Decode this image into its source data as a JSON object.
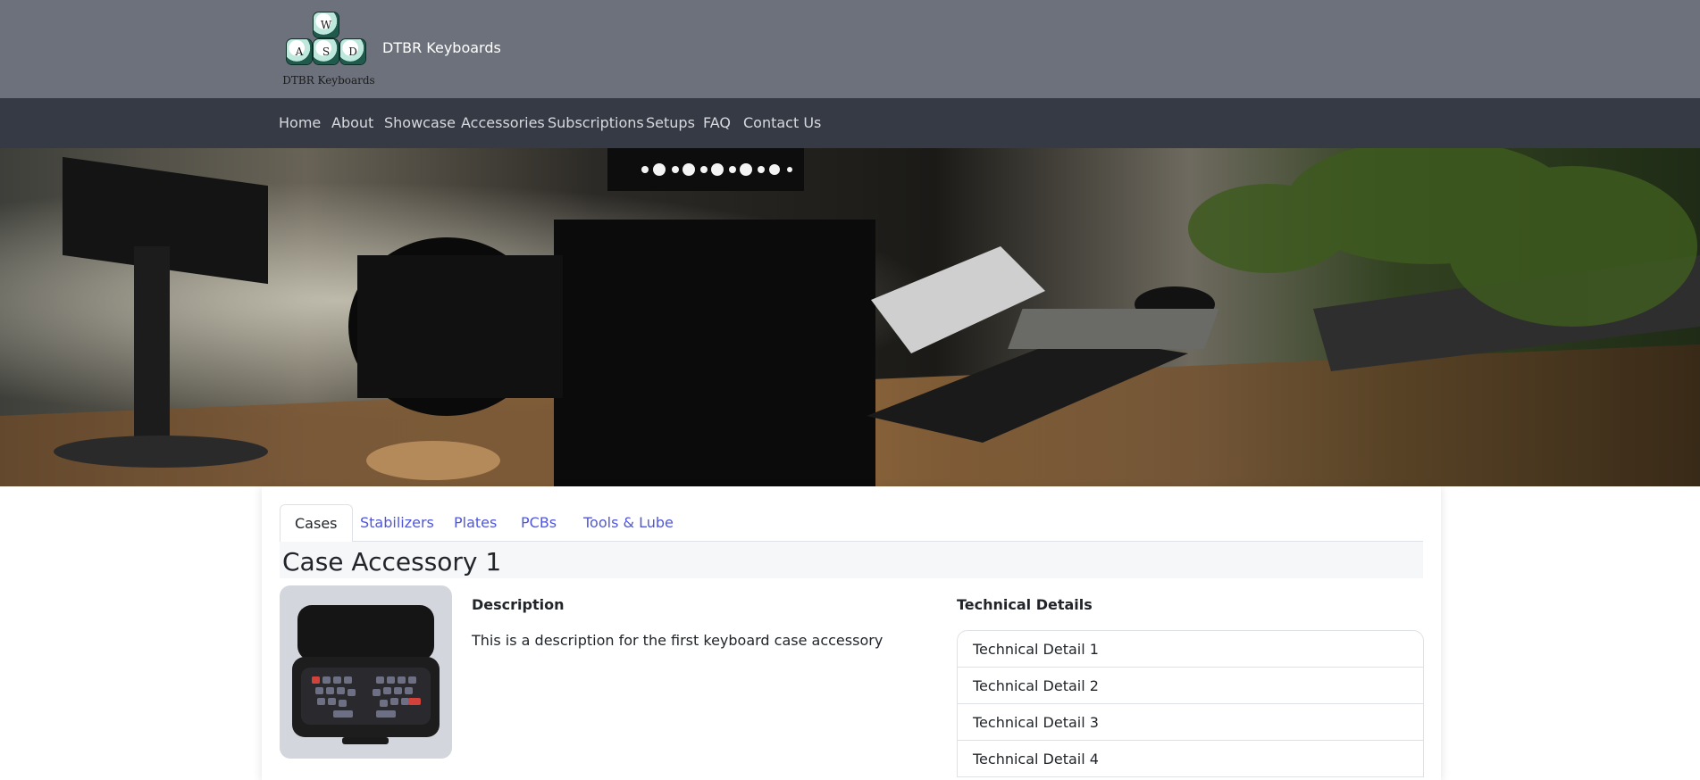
{
  "brand": {
    "title": "DTBR Keyboards",
    "logo_keys": [
      "W",
      "A",
      "S",
      "D"
    ],
    "logo_text": "DTBR Keyboards"
  },
  "nav": {
    "items": [
      "Home",
      "About",
      "Showcase",
      "Accessories",
      "Subscriptions",
      "Setups",
      "FAQ",
      "Contact Us"
    ]
  },
  "tabs": {
    "items": [
      "Cases",
      "Stabilizers",
      "Plates",
      "PCBs",
      "Tools & Lube"
    ],
    "active": "Cases"
  },
  "product": {
    "title": "Case Accessory 1",
    "description_heading": "Description",
    "description": "This is a description for the first keyboard case accessory",
    "tech_heading": "Technical Details",
    "tech_details": [
      "Technical Detail 1",
      "Technical Detail 2",
      "Technical Detail 3",
      "Technical Detail 4"
    ]
  },
  "colors": {
    "topbar": "#6c717b",
    "navbar": "#363a45",
    "link": "#4f56dd"
  }
}
